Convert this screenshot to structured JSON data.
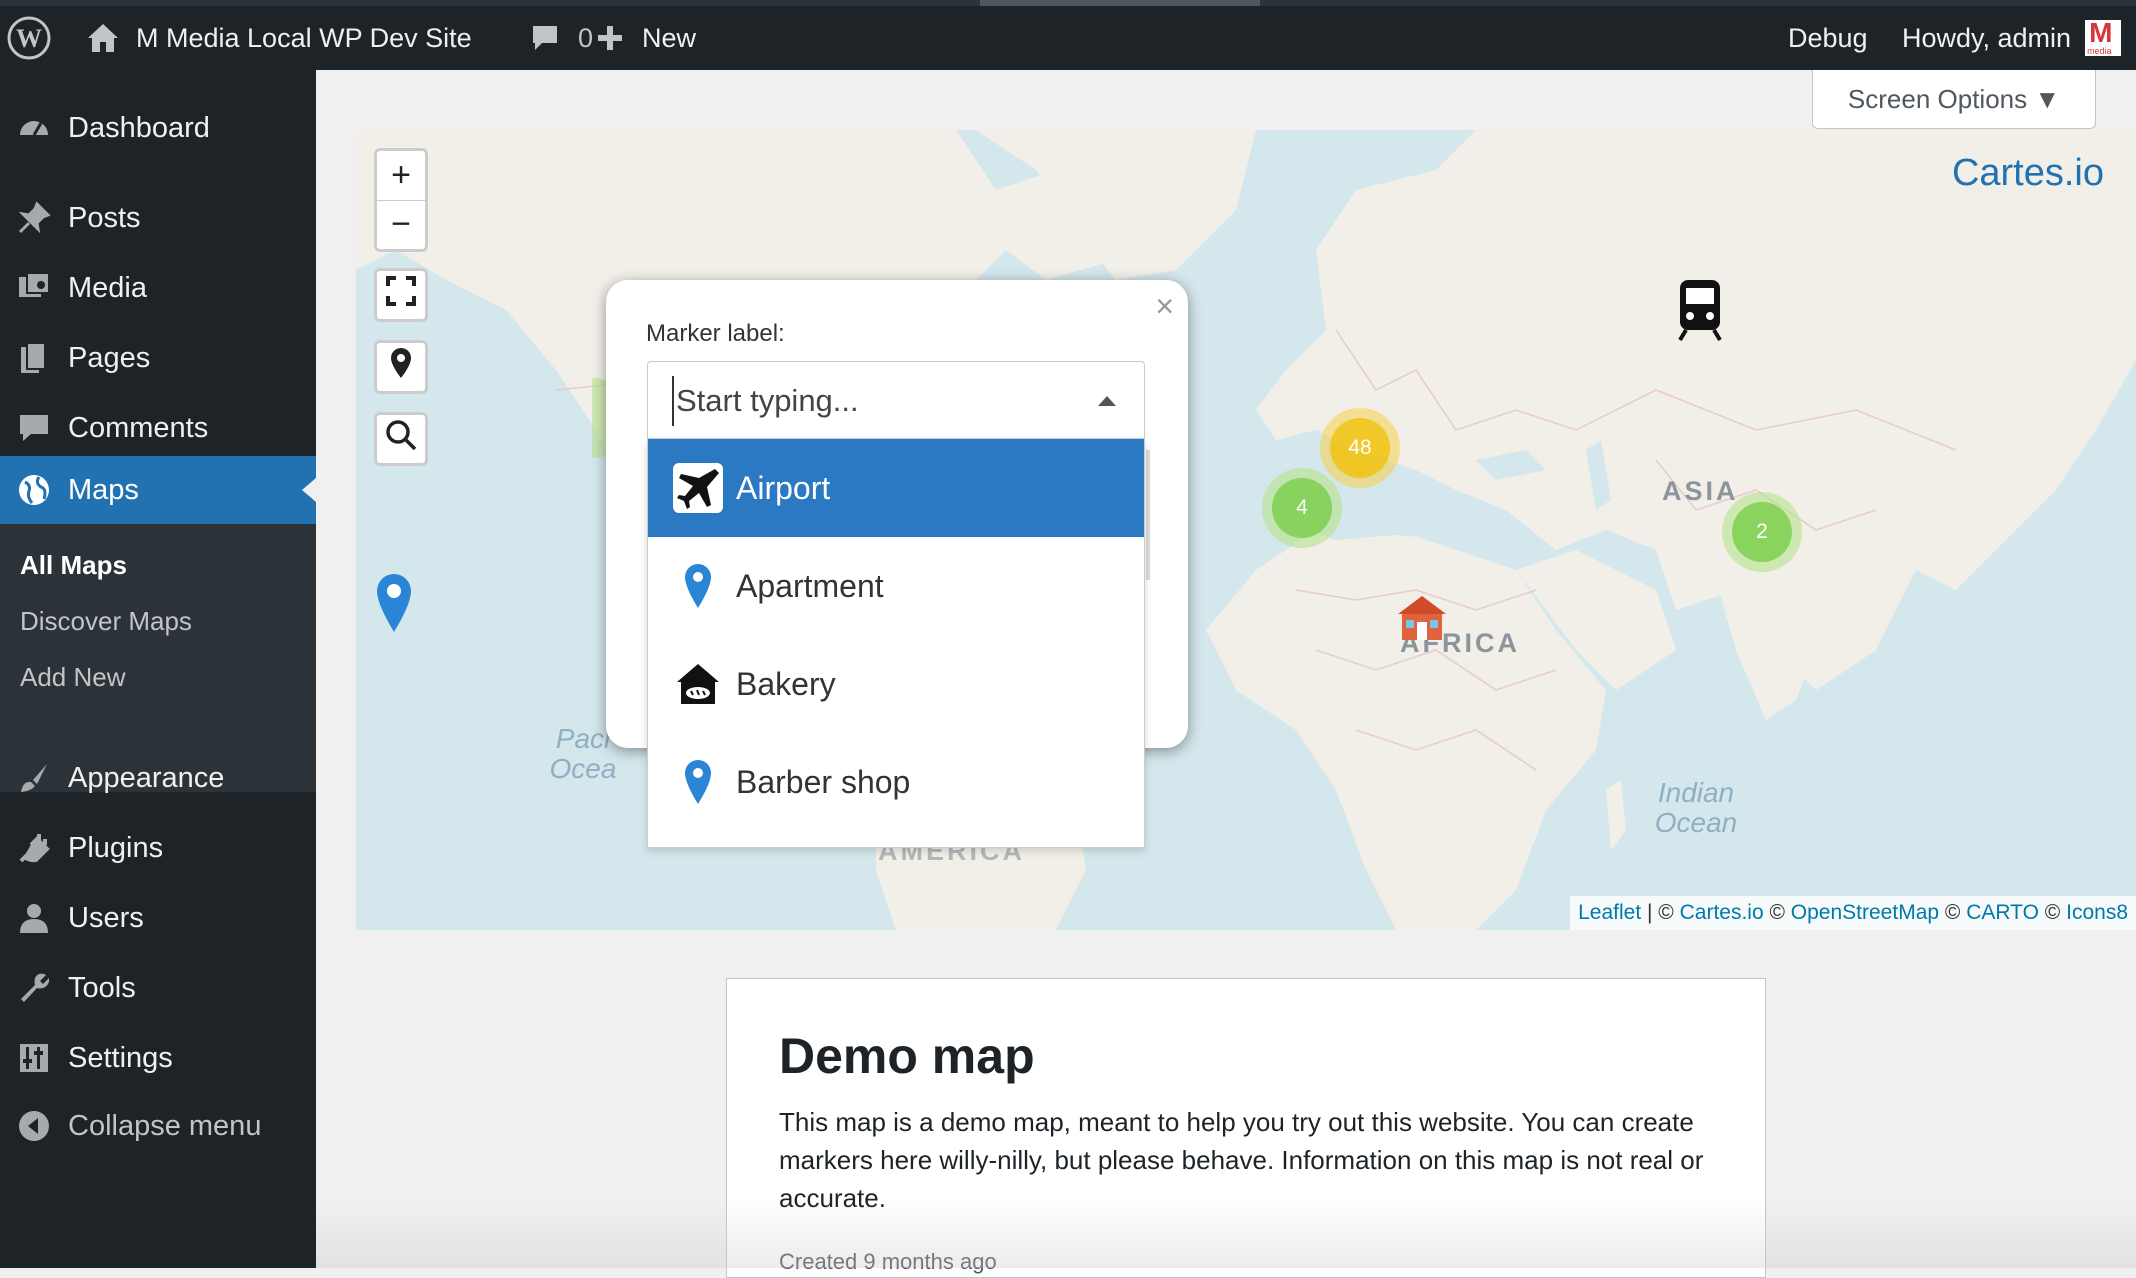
{
  "admin_bar": {
    "site_name": "M Media Local WP Dev Site",
    "comments_count": "0",
    "new_label": "New",
    "debug_label": "Debug",
    "greeting": "Howdy, admin",
    "avatar_letter": "M",
    "avatar_caption": "media"
  },
  "sidebar": {
    "items": [
      {
        "label": "Dashboard",
        "icon": "dashboard-icon"
      },
      {
        "label": "Posts",
        "icon": "pin-icon"
      },
      {
        "label": "Media",
        "icon": "media-icon"
      },
      {
        "label": "Pages",
        "icon": "pages-icon"
      },
      {
        "label": "Comments",
        "icon": "comment-icon"
      },
      {
        "label": "Maps",
        "icon": "globe-icon",
        "current": true
      },
      {
        "label": "Appearance",
        "icon": "brush-icon"
      },
      {
        "label": "Plugins",
        "icon": "plug-icon"
      },
      {
        "label": "Users",
        "icon": "user-icon"
      },
      {
        "label": "Tools",
        "icon": "wrench-icon"
      },
      {
        "label": "Settings",
        "icon": "settings-icon"
      }
    ],
    "submenu": [
      "All Maps",
      "Discover Maps",
      "Add New"
    ],
    "collapse_label": "Collapse menu"
  },
  "screen_options": {
    "label": "Screen Options ▼"
  },
  "map": {
    "brand": "Cartes.io",
    "zoom_in": "+",
    "zoom_out": "−",
    "labels": {
      "asia": "ASIA",
      "africa": "AFRICA",
      "america": "AMERICA",
      "indian_ocean": "Indian Ocean",
      "pacific_ocean": "Paci Ocea"
    },
    "clusters": [
      "48",
      "4",
      "2"
    ],
    "attribution": {
      "leaflet": "Leaflet",
      "sep1": " | © ",
      "cartes": "Cartes.io",
      "sep2": " © ",
      "osm": "OpenStreetMap",
      "sep3": " © ",
      "carto": "CARTO",
      "sep4": " © ",
      "icons8": "Icons8"
    }
  },
  "popup": {
    "close": "×",
    "field_label": "Marker label:",
    "placeholder": "Start typing...",
    "options": [
      {
        "label": "Airport",
        "icon": "airplane-icon",
        "selected": true
      },
      {
        "label": "Apartment",
        "icon": "map-pin-icon"
      },
      {
        "label": "Bakery",
        "icon": "bakery-icon"
      },
      {
        "label": "Barber shop",
        "icon": "map-pin-icon"
      }
    ]
  },
  "card": {
    "title": "Demo map",
    "description": "This map is a demo map, meant to help you try out this website. You can create markers here willy-nilly, but please behave. Information on this map is not real or accurate.",
    "created": "Created 9 months ago"
  },
  "colors": {
    "admin_bg": "#1d2327",
    "accent": "#2271b1",
    "map_water": "#d4e7ec",
    "map_land": "#f2efe9",
    "cluster_orange": "#f0c20c",
    "cluster_green": "#6ecc39"
  }
}
